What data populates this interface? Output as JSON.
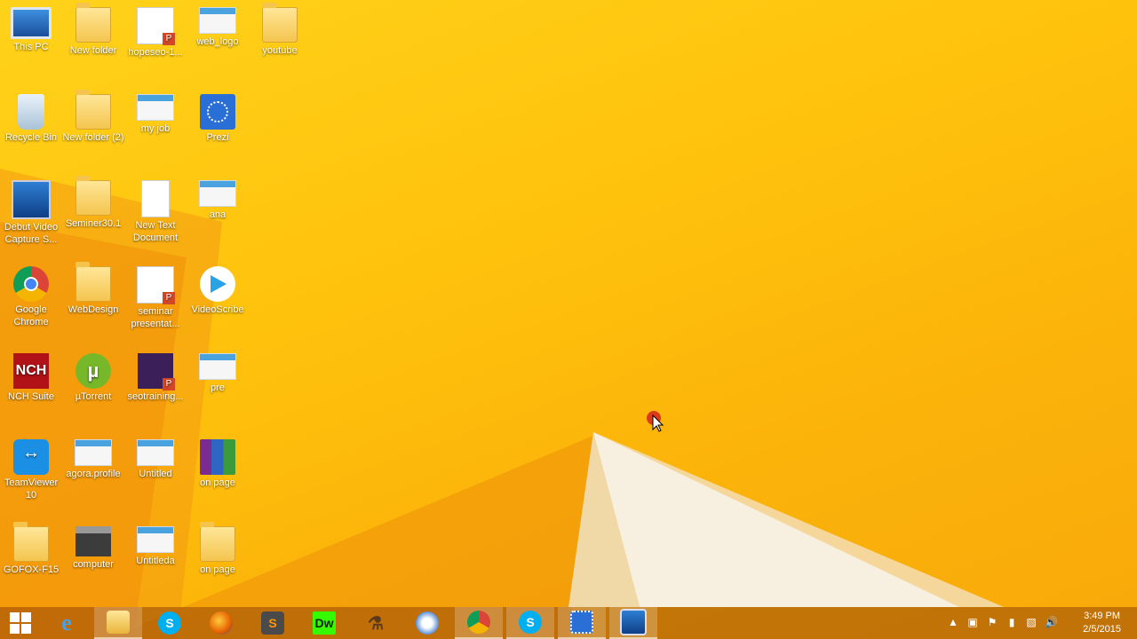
{
  "desktop": {
    "icons": [
      {
        "label": "This PC",
        "icon": "this-pc-icon"
      },
      {
        "label": "New folder",
        "icon": "folder-icon"
      },
      {
        "label": "hopeseo-1...",
        "icon": "pdf-document-icon"
      },
      {
        "label": "web_logo",
        "icon": "image-file-icon"
      },
      {
        "label": "youtube",
        "icon": "folder-icon"
      },
      {
        "label": "Recycle Bin",
        "icon": "recycle-bin-icon"
      },
      {
        "label": "New folder (2)",
        "icon": "folder-icon"
      },
      {
        "label": "my job",
        "icon": "webpage-file-icon"
      },
      {
        "label": "Prezi",
        "icon": "prezi-icon"
      },
      {
        "label": "Debut Video Capture S...",
        "icon": "video-capture-icon"
      },
      {
        "label": "Seminer30.1",
        "icon": "folder-icon"
      },
      {
        "label": "New Text Document",
        "icon": "text-document-icon"
      },
      {
        "label": "ana",
        "icon": "image-file-icon"
      },
      {
        "label": "Google Chrome",
        "icon": "chrome-icon"
      },
      {
        "label": "WebDesign",
        "icon": "folder-icon"
      },
      {
        "label": "seminar presentat...",
        "icon": "powerpoint-file-icon"
      },
      {
        "label": "VideoScribe",
        "icon": "videoscribe-icon"
      },
      {
        "label": "NCH Suite",
        "icon": "nch-suite-icon"
      },
      {
        "label": "µTorrent",
        "icon": "utorrent-icon"
      },
      {
        "label": "seotraining...",
        "icon": "powerpoint-file-icon"
      },
      {
        "label": "pre",
        "icon": "image-file-icon"
      },
      {
        "label": "TeamViewer 10",
        "icon": "teamviewer-icon"
      },
      {
        "label": "agora.profile",
        "icon": "image-file-icon"
      },
      {
        "label": "Untitled",
        "icon": "webpage-file-icon"
      },
      {
        "label": "on page",
        "icon": "winrar-archive-icon"
      },
      {
        "label": "GOFOX-F15",
        "icon": "folder-icon"
      },
      {
        "label": "computer",
        "icon": "computer-icon"
      },
      {
        "label": "Untitleda",
        "icon": "webpage-file-icon"
      },
      {
        "label": "on page",
        "icon": "folder-icon"
      }
    ]
  },
  "taskbar": {
    "buttons": [
      {
        "name": "start-button",
        "icon": "windows-logo-icon"
      },
      {
        "name": "internet-explorer",
        "icon": "internet-explorer-icon"
      },
      {
        "name": "file-explorer",
        "icon": "file-explorer-icon"
      },
      {
        "name": "skype",
        "icon": "skype-icon"
      },
      {
        "name": "firefox",
        "icon": "firefox-icon"
      },
      {
        "name": "sublime-text",
        "icon": "sublime-text-icon"
      },
      {
        "name": "dreamweaver",
        "icon": "dreamweaver-icon",
        "text": "Dw"
      },
      {
        "name": "network-app",
        "icon": "network-app-icon"
      },
      {
        "name": "opera",
        "icon": "browser-globe-icon"
      },
      {
        "name": "google-chrome",
        "icon": "chrome-icon"
      },
      {
        "name": "skype-business",
        "icon": "skype-icon"
      },
      {
        "name": "prezi",
        "icon": "prezi-icon"
      },
      {
        "name": "video-capture",
        "icon": "video-capture-icon"
      }
    ],
    "tray": {
      "time": "3:49 PM",
      "date": "2/5/2015"
    }
  },
  "colors": {
    "wallpaper": "#ffc20c",
    "wallpaper_accent": "#f08a0a",
    "taskbar": "#96460580"
  }
}
